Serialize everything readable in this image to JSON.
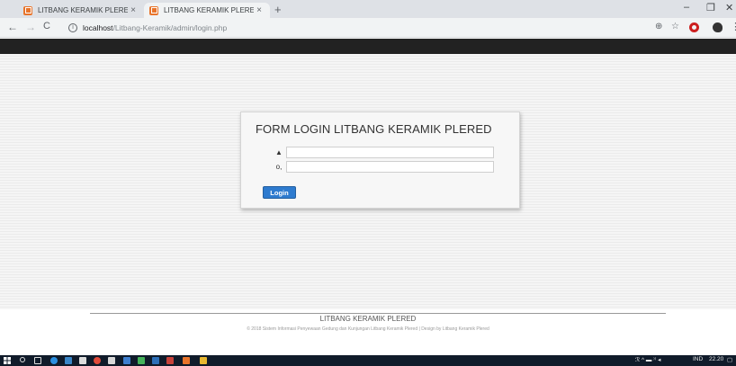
{
  "browser": {
    "tabs": [
      {
        "title": "LITBANG KERAMIK PLERED",
        "close": "×"
      },
      {
        "title": "LITBANG KERAMIK PLERED",
        "close": "×"
      }
    ],
    "new_tab": "+",
    "window_controls": {
      "minimize": "–",
      "restore": "❐",
      "close": "✕"
    },
    "nav": {
      "back": "←",
      "forward": "→",
      "reload": "C"
    },
    "url_host": "localhost",
    "url_path": "/Litbang-Keramik/admin/login.php",
    "toolbar_icons": [
      "zoom-icon",
      "star-icon",
      "opera-icon",
      "extension-icon",
      "menu-icon"
    ],
    "zoom_glyph": "⊕",
    "star_glyph": "☆",
    "menu_glyph": "⋮",
    "info_glyph": "i"
  },
  "login": {
    "title": "FORM LOGIN LITBANG KERAMIK PLERED",
    "username_value": "",
    "password_value": "",
    "user_icon": "▲",
    "key_icon": "o,",
    "button_label": "Login"
  },
  "footer": {
    "title": "LITBANG KERAMIK PLERED",
    "copyright": "© 2018 Sistem Informasi Penyewaan Gedung dan Kunjungan Litbang Keramik Plered | Design by Litbang Keramik Plered"
  },
  "taskbar": {
    "language": "IND",
    "time": "22.20",
    "tray_glyphs": "ℛ ^ ▬ ⁾⁾ ◂",
    "notification_glyph": "▢"
  },
  "colors": {
    "navbar": "#222222",
    "button": "#2e7bcf",
    "favicon": "#e8742b",
    "taskbar": "#101b2a"
  }
}
